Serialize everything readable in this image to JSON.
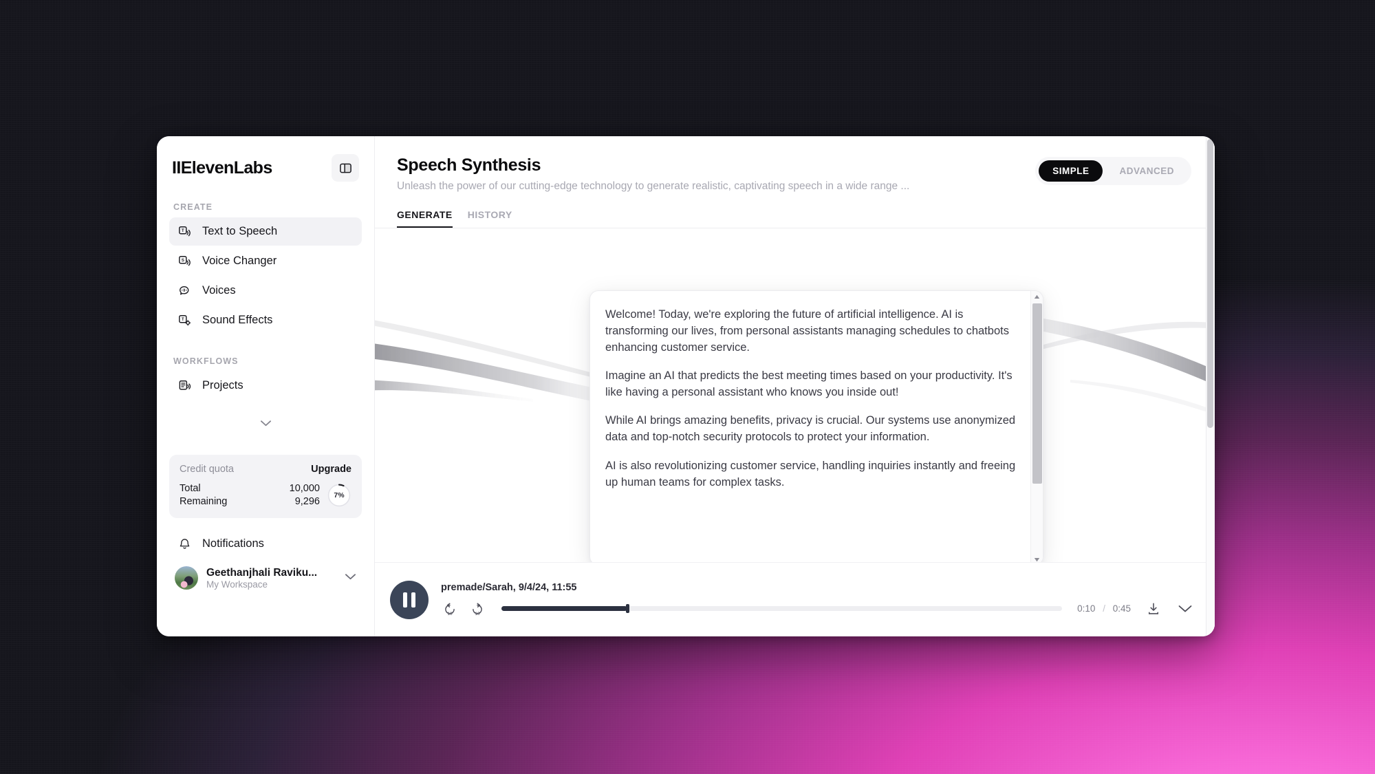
{
  "app": {
    "brand": "IIElevenLabs"
  },
  "sidebar": {
    "panel_toggle_icon": "panel-layout-icon",
    "sections": [
      {
        "label": "CREATE",
        "items": [
          {
            "label": "Text to Speech",
            "icon": "text-to-speech-icon",
            "active": true
          },
          {
            "label": "Voice Changer",
            "icon": "voice-changer-icon",
            "active": false
          },
          {
            "label": "Voices",
            "icon": "voices-icon",
            "active": false
          },
          {
            "label": "Sound Effects",
            "icon": "sound-effects-icon",
            "active": false
          }
        ]
      },
      {
        "label": "WORKFLOWS",
        "items": [
          {
            "label": "Projects",
            "icon": "projects-icon",
            "active": false
          }
        ]
      }
    ],
    "expander_icon": "chevron-down-icon",
    "quota": {
      "title": "Credit quota",
      "upgrade_label": "Upgrade",
      "total_label": "Total",
      "total_value": "10,000",
      "remaining_label": "Remaining",
      "remaining_value": "9,296",
      "percent_label": "7%",
      "percent_value": 7
    },
    "notifications": {
      "label": "Notifications",
      "icon": "bell-icon"
    },
    "user": {
      "name": "Geethanjhali Raviku...",
      "workspace": "My Workspace",
      "chevron_icon": "chevron-down-icon"
    }
  },
  "header": {
    "title": "Speech Synthesis",
    "subtitle": "Unleash the power of our cutting-edge technology to generate realistic, captivating speech in a wide range ...",
    "mode_toggle": {
      "options": [
        "SIMPLE",
        "ADVANCED"
      ],
      "selected": "SIMPLE"
    },
    "tabs": [
      {
        "label": "GENERATE",
        "active": true
      },
      {
        "label": "HISTORY",
        "active": false
      }
    ]
  },
  "editor": {
    "paragraphs": [
      "Welcome! Today, we're exploring the future of artificial intelligence. AI is transforming our lives, from personal assistants managing schedules to chatbots enhancing customer service.",
      "Imagine an AI that predicts the best meeting times based on your productivity. It's like having a personal assistant who knows you inside out!",
      "While AI brings amazing benefits, privacy is crucial. Our systems use anonymized data and top-notch security protocols to protect your information.",
      "AI is also revolutionizing customer service, handling inquiries instantly and freeing up human teams for complex tasks."
    ],
    "scroll_up_icon": "scroll-up-arrow-icon",
    "scroll_down_icon": "scroll-down-arrow-icon"
  },
  "player": {
    "play_state_icon": "pause-icon",
    "title": "premade/Sarah, 9/4/24, 11:55",
    "rewind_icon": "rewind-10-icon",
    "forward_icon": "forward-10-icon",
    "current_time": "0:10",
    "time_separator": "/",
    "total_time": "0:45",
    "progress_percent": 22.5,
    "download_icon": "download-icon",
    "collapse_icon": "chevron-down-icon"
  },
  "colors": {
    "accent_dark": "#0b0b0d",
    "player_button": "#3b4558",
    "progress_fill": "#2c3140",
    "sidebar_active": "#f2f2f5",
    "muted_text": "#a8a8b2"
  }
}
